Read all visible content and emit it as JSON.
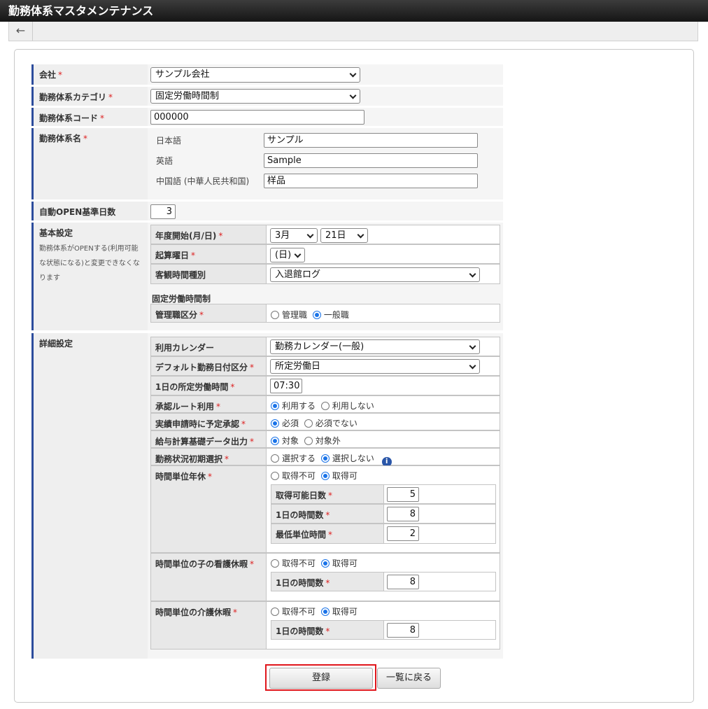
{
  "title": "勤務体系マスタメンテナンス",
  "back_icon": "←",
  "fields": {
    "company": {
      "label": "会社",
      "value": "サンプル会社"
    },
    "category": {
      "label": "勤務体系カテゴリ",
      "value": "固定労働時間制"
    },
    "code": {
      "label": "勤務体系コード",
      "value": "000000"
    },
    "name": {
      "label": "勤務体系名",
      "langs": [
        {
          "label": "日本語",
          "value": "サンプル"
        },
        {
          "label": "英語",
          "value": "Sample"
        },
        {
          "label": "中国語 (中華人民共和国)",
          "value": "样品"
        }
      ]
    },
    "auto_open": {
      "label": "自動OPEN基準日数",
      "value": "3"
    }
  },
  "basic": {
    "label": "基本設定",
    "note": "勤務体系がOPENする(利用可能な状態になる)と変更できなくなります",
    "year_start": {
      "label": "年度開始(月/日)",
      "month": "3月",
      "day": "21日"
    },
    "weekday": {
      "label": "起算曜日",
      "value": "(日)"
    },
    "objective": {
      "label": "客観時間種別",
      "value": "入退館ログ"
    },
    "section": "固定労働時間制",
    "manager": {
      "label": "管理職区分",
      "opt1": "管理職",
      "opt2": "一般職"
    }
  },
  "detail": {
    "label": "詳細設定",
    "calendar": {
      "label": "利用カレンダー",
      "value": "勤務カレンダー(一般)"
    },
    "default_day": {
      "label": "デフォルト勤務日付区分",
      "value": "所定労働日"
    },
    "hours": {
      "label": "1日の所定労働時間",
      "value": "07:30"
    },
    "route": {
      "label": "承認ルート利用",
      "opt1": "利用する",
      "opt2": "利用しない"
    },
    "plan": {
      "label": "実績申請時に予定承認",
      "opt1": "必須",
      "opt2": "必須でない"
    },
    "payroll": {
      "label": "給与計算基礎データ出力",
      "opt1": "対象",
      "opt2": "対象外"
    },
    "status": {
      "label": "勤務状況初期選択",
      "opt1": "選択する",
      "opt2": "選択しない",
      "info": "i"
    },
    "hourly_leave": {
      "label": "時間単位年休",
      "opt1": "取得不可",
      "opt2": "取得可",
      "days_label": "取得可能日数",
      "days": "5",
      "hours_label": "1日の時間数",
      "hours": "8",
      "min_label": "最低単位時間",
      "min": "2"
    },
    "child": {
      "label": "時間単位の子の看護休暇",
      "opt1": "取得不可",
      "opt2": "取得可",
      "hours_label": "1日の時間数",
      "hours": "8"
    },
    "care": {
      "label": "時間単位の介護休暇",
      "opt1": "取得不可",
      "opt2": "取得可",
      "hours_label": "1日の時間数",
      "hours": "8"
    }
  },
  "buttons": {
    "register": "登録",
    "back_list": "一覧に戻る"
  },
  "colors": {
    "accent_bar": "#2c4c9c",
    "highlight": "#e0161c",
    "radio": "#1a73e8"
  }
}
